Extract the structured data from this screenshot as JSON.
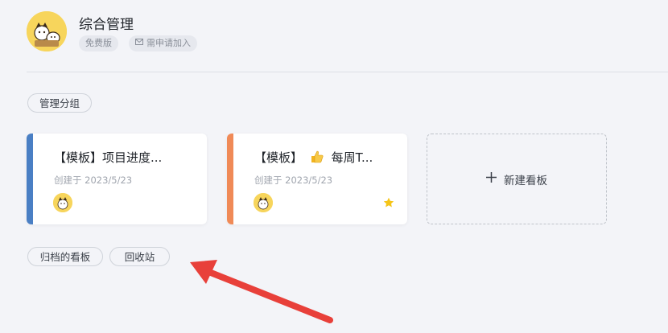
{
  "workspace": {
    "title": "综合管理",
    "plan_tag": "免费版",
    "invite_tag": "需申请加入"
  },
  "group_button": "管理分组",
  "boards": [
    {
      "title": "【模板】项目进度...",
      "created": "创建于 2023/5/23",
      "accent": "#4a7fc4",
      "starred": false
    },
    {
      "title": "【模板】",
      "title_tail": "每周T...",
      "created": "创建于 2023/5/23",
      "accent": "#f08a57",
      "starred": true
    }
  ],
  "new_board_label": "新建看板",
  "bottom_links": {
    "archived": "归档的看板",
    "recycle": "回收站"
  },
  "colors": {
    "star": "#f5c518",
    "arrow": "#e8403a"
  }
}
